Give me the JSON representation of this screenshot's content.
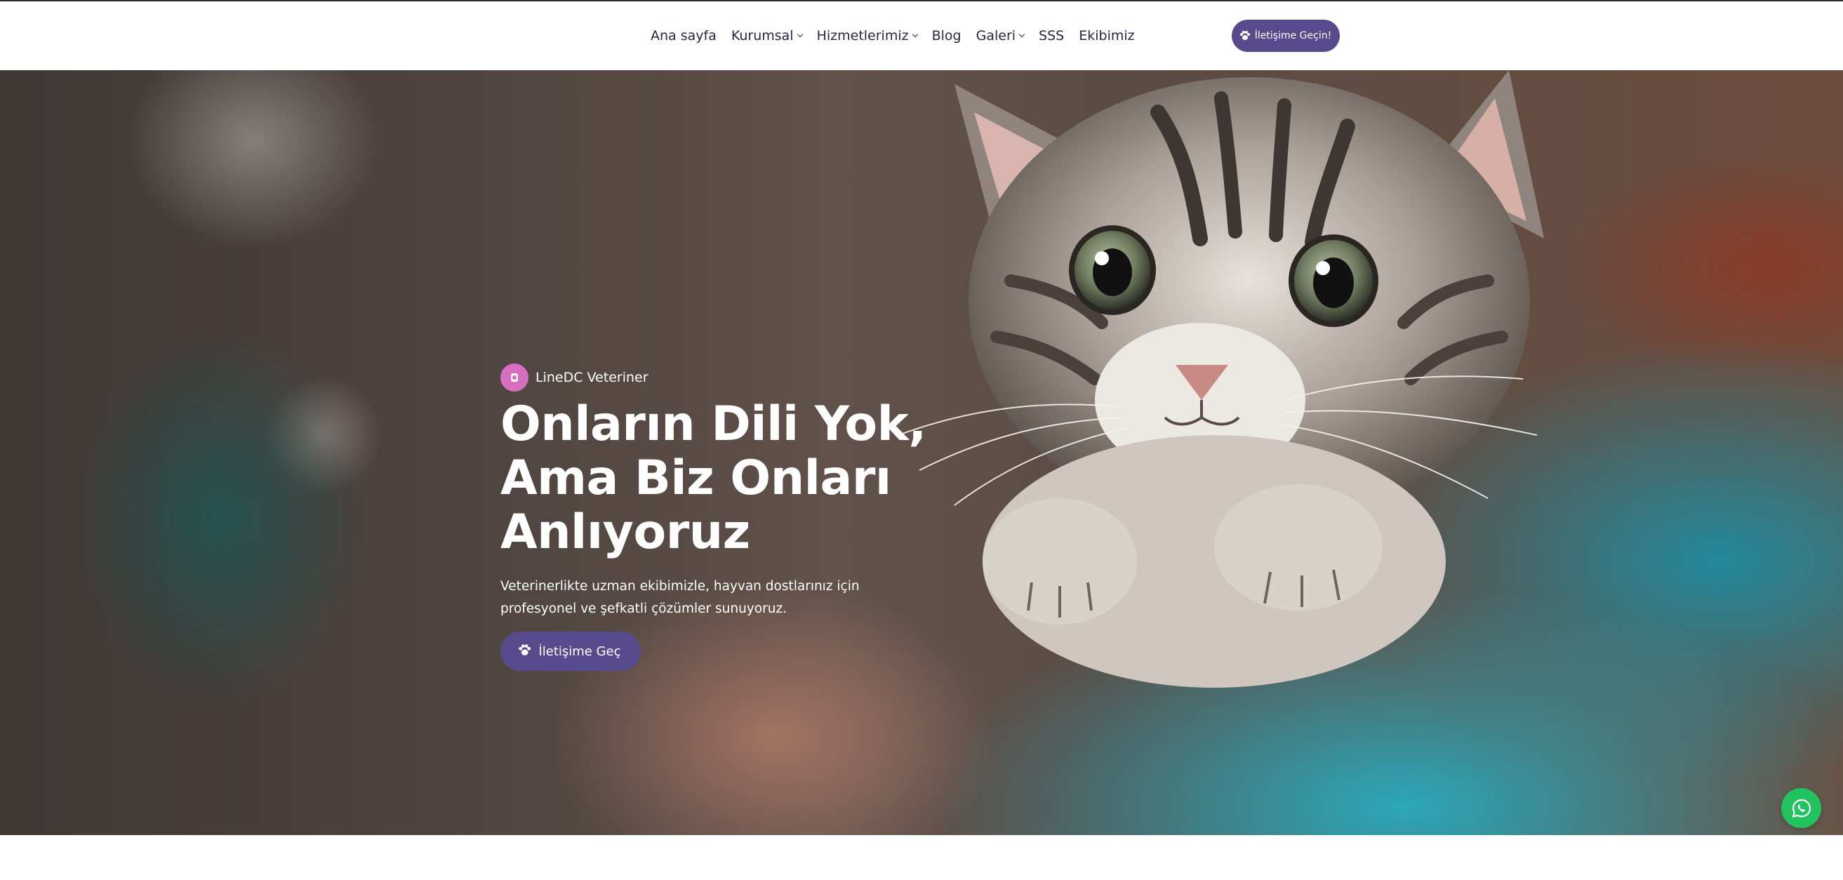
{
  "nav": {
    "items": [
      {
        "label": "Ana sayfa",
        "dropdown": false
      },
      {
        "label": "Kurumsal",
        "dropdown": true
      },
      {
        "label": "Hizmetlerimiz",
        "dropdown": true
      },
      {
        "label": "Blog",
        "dropdown": false
      },
      {
        "label": "Galeri",
        "dropdown": true
      },
      {
        "label": "SSS",
        "dropdown": false
      },
      {
        "label": "Ekibimiz",
        "dropdown": false
      }
    ]
  },
  "header": {
    "cta_label": "İletişime Geçin!",
    "cta_icon": "paw-icon"
  },
  "hero": {
    "badge_text": "LineDC Veteriner",
    "badge_icon": "vet-icon",
    "headline": [
      "Onların Dili Yok,",
      "Ama Biz Onları",
      "Anlıyoruz"
    ],
    "subtext": "Veterinerlikte uzman ekibimizle, hayvan dostlarınız için profesyonel ve şefkatli çözümler sunuyoruz.",
    "cta_label": "İletişime Geç",
    "cta_icon": "paw-icon",
    "slider": {
      "total": 2,
      "active": 1
    }
  },
  "floating": {
    "icon": "whatsapp-icon"
  },
  "colors": {
    "accent": "#574a8d",
    "badge": "#d66fc0",
    "whatsapp": "#22c35e",
    "nav_text": "#2b2545"
  }
}
